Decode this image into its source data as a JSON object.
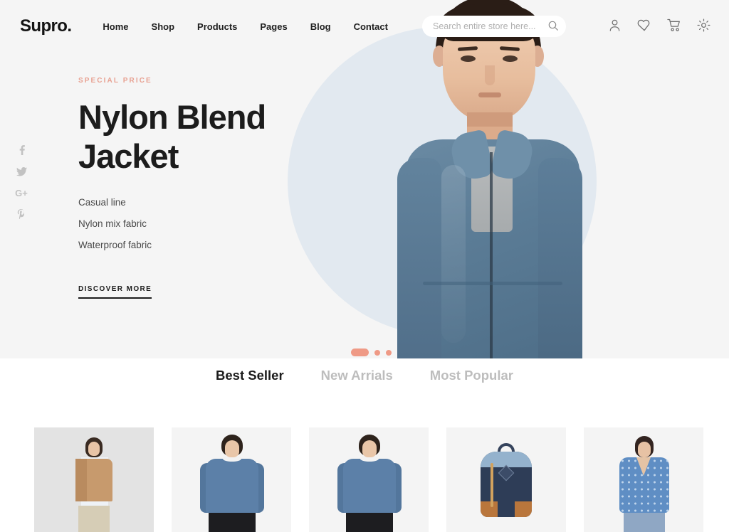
{
  "brand": {
    "name": "Supro."
  },
  "nav": {
    "items": [
      {
        "label": "Home"
      },
      {
        "label": "Shop"
      },
      {
        "label": "Products"
      },
      {
        "label": "Pages"
      },
      {
        "label": "Blog"
      },
      {
        "label": "Contact"
      }
    ]
  },
  "search": {
    "placeholder": "Search entire store here...",
    "value": "",
    "icon": "search-icon"
  },
  "header_icons": [
    {
      "name": "account-icon"
    },
    {
      "name": "wishlist-heart-icon"
    },
    {
      "name": "cart-icon"
    },
    {
      "name": "settings-gear-icon"
    }
  ],
  "social": [
    {
      "name": "facebook-icon",
      "label": "f"
    },
    {
      "name": "twitter-icon",
      "label": ""
    },
    {
      "name": "google-plus-icon",
      "label": "G+"
    },
    {
      "name": "pinterest-icon",
      "label": "P"
    }
  ],
  "hero": {
    "eyebrow": "SPECIAL PRICE",
    "title": "Nylon Blend Jacket",
    "features": [
      "Casual line",
      "Nylon mix fabric",
      "Waterproof fabric"
    ],
    "cta": "DISCOVER MORE",
    "accent_color": "#e8a192",
    "panel_color": "#f5f5f5",
    "circle_color": "#e2e9f0"
  },
  "carousel": {
    "slides": 3,
    "active_index": 0,
    "dot_color": "#ef9a86"
  },
  "tabs": [
    {
      "label": "Best Seller",
      "active": true
    },
    {
      "label": "New Arrials",
      "active": false
    },
    {
      "label": "Most Popular",
      "active": false
    }
  ],
  "products": [
    {
      "name": "product-card-1"
    },
    {
      "name": "product-card-2"
    },
    {
      "name": "product-card-3"
    },
    {
      "name": "product-card-4"
    },
    {
      "name": "product-card-5"
    }
  ]
}
